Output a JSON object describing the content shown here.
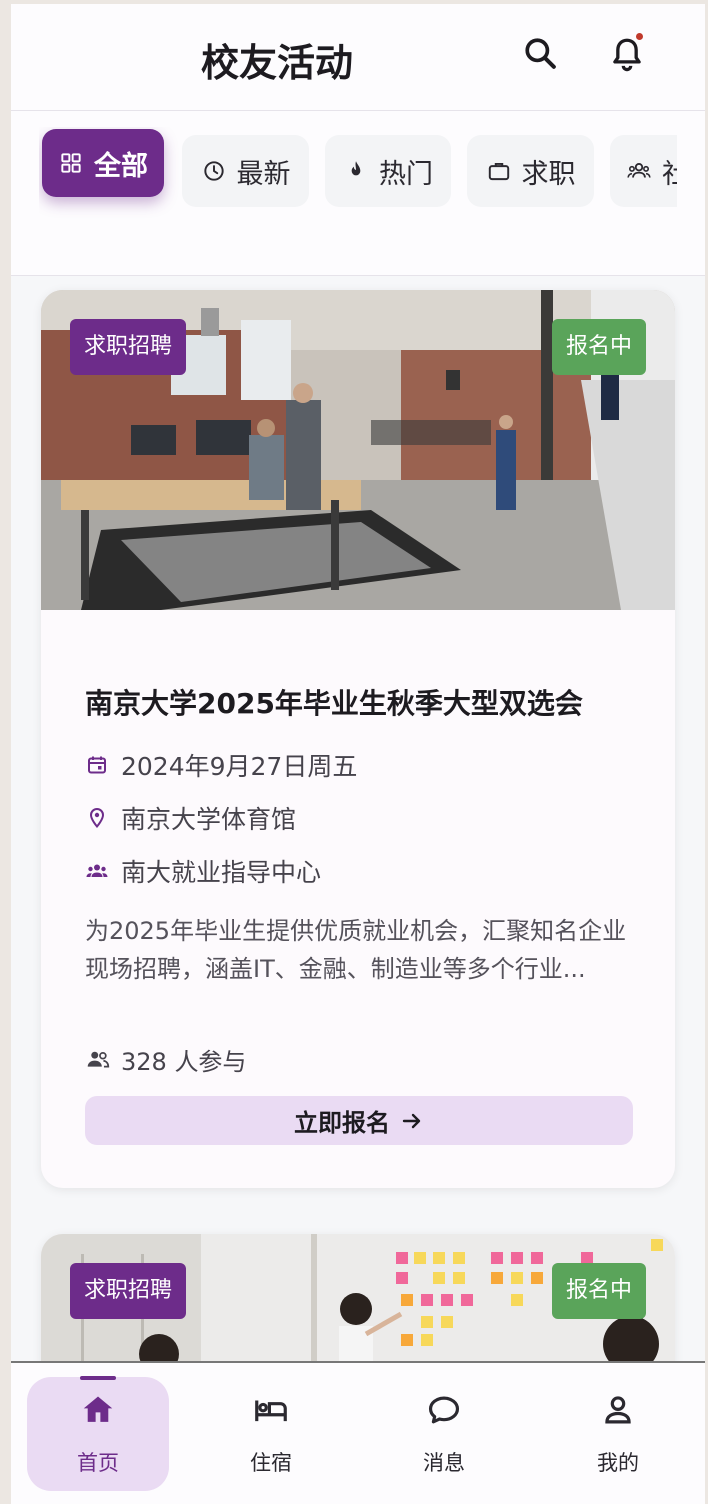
{
  "header": {
    "title": "校友活动",
    "search_icon": "search-icon",
    "notification_icon": "bell-icon"
  },
  "filters": {
    "chips": [
      {
        "label": "全部",
        "icon": "grid-icon",
        "active": true
      },
      {
        "label": "最新",
        "icon": "clock-icon",
        "active": false
      },
      {
        "label": "热门",
        "icon": "flame-icon",
        "active": false
      },
      {
        "label": "求职",
        "icon": "briefcase-icon",
        "active": false
      },
      {
        "label": "社",
        "icon": "group-icon",
        "active": false
      }
    ]
  },
  "events": [
    {
      "category": "求职招聘",
      "status": "报名中",
      "title": "南京大学2025年毕业生秋季大型双选会",
      "date": "2024年9月27日周五",
      "location": "南京大学体育馆",
      "organizer": "南大就业指导中心",
      "description": "为2025年毕业生提供优质就业机会，汇聚知名企业现场招聘，涵盖IT、金融、制造业等多个行业...",
      "participants": "328 人参与",
      "cta": "立即报名"
    },
    {
      "category": "求职招聘",
      "status": "报名中"
    }
  ],
  "bottom_nav": [
    {
      "label": "首页",
      "icon": "home-icon",
      "active": true
    },
    {
      "label": "住宿",
      "icon": "bed-icon",
      "active": false
    },
    {
      "label": "消息",
      "icon": "chat-bubble-icon",
      "active": false
    },
    {
      "label": "我的",
      "icon": "person-icon",
      "active": false
    }
  ],
  "colors": {
    "accent": "#6d2c8a",
    "status_green": "#5aa45a",
    "cta_bg": "#eadbf3"
  }
}
